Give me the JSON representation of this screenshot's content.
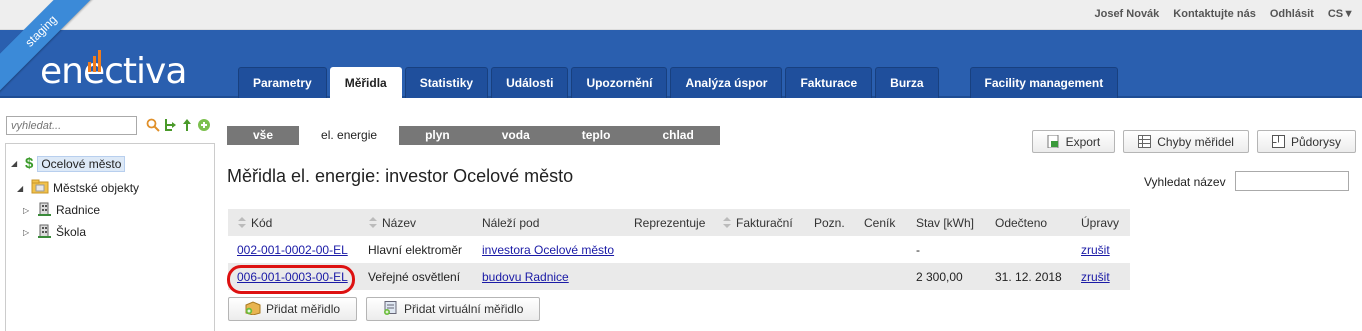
{
  "environment": "staging",
  "brand": {
    "logo_text": "enectiva",
    "accent": "#f07c1c",
    "header_color": "#2a5faf"
  },
  "top_links": {
    "user": "Josef Novák",
    "contact": "Kontaktujte nás",
    "logout": "Odhlásit",
    "language": "CS▼"
  },
  "tabs": [
    {
      "label": "Parametry"
    },
    {
      "label": "Měřidla",
      "active": true
    },
    {
      "label": "Statistiky"
    },
    {
      "label": "Události"
    },
    {
      "label": "Upozornění"
    },
    {
      "label": "Analýza úspor"
    },
    {
      "label": "Fakturace"
    },
    {
      "label": "Burza"
    },
    {
      "label": "Facility management"
    }
  ],
  "sidebar": {
    "search_placeholder": "vyhledat...",
    "tree": [
      {
        "label": "Ocelové město",
        "icon": "dollar-icon"
      },
      {
        "label": "Městské objekty",
        "icon": "folder-icon"
      },
      {
        "label": "Radnice",
        "icon": "building-icon"
      },
      {
        "label": "Škola",
        "icon": "building-icon"
      }
    ]
  },
  "energy_filters": [
    "vše",
    "el. energie",
    "plyn",
    "voda",
    "teplo",
    "chlad"
  ],
  "active_filter": "el. energie",
  "actions": {
    "export": "Export",
    "errors": "Chyby měřidel",
    "plans": "Půdorysy"
  },
  "page_title": "Měřidla el. energie: investor Ocelové město",
  "find": {
    "label": "Vyhledat název"
  },
  "table": {
    "headers": [
      "Kód",
      "Název",
      "Náleží pod",
      "Reprezentuje",
      "Fakturační",
      "Pozn.",
      "Ceník",
      "Stav [kWh]",
      "Odečteno",
      "Úpravy"
    ],
    "rows": [
      {
        "code": "002-001-0002-00-EL",
        "name": "Hlavní elektroměr",
        "parent": "investora Ocelové město",
        "state": "-",
        "read": "",
        "action": "zrušit"
      },
      {
        "code": "006-001-0003-00-EL",
        "name": "Veřejné osvětlení",
        "parent": "budovu Radnice",
        "state": "2 300,00",
        "read": "31. 12. 2018",
        "action": "zrušit"
      }
    ]
  },
  "bottom_buttons": {
    "add_meter": "Přidat měřidlo",
    "add_virtual": "Přidat virtuální měřidlo"
  }
}
